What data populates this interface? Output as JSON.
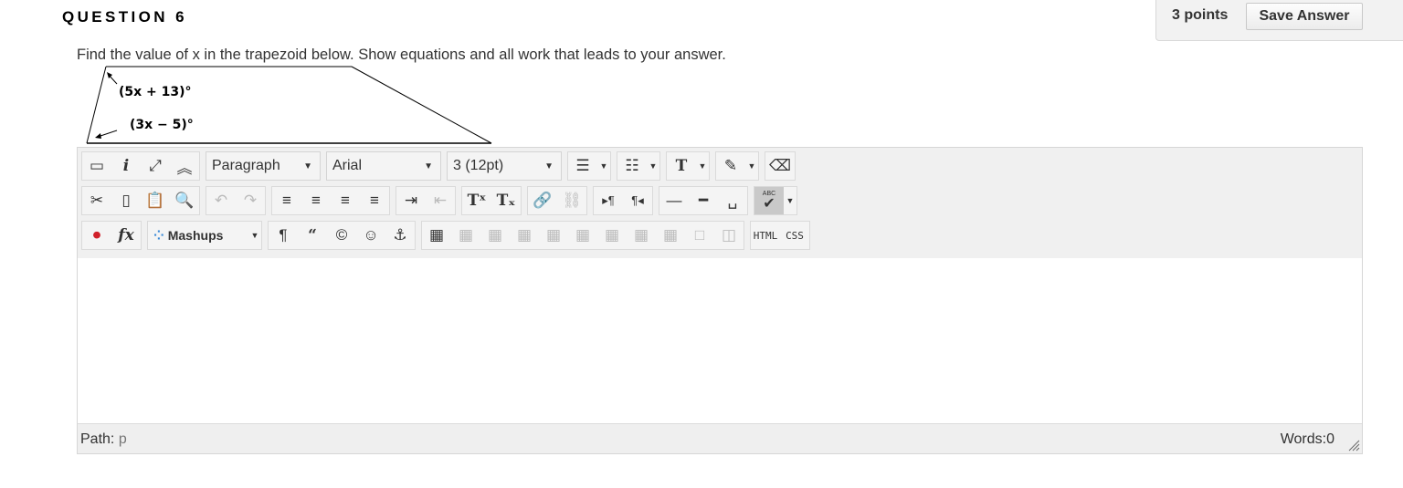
{
  "question": {
    "title": "QUESTION 6",
    "points": "3 points",
    "save_label": "Save Answer",
    "prompt": "Find the value of x in the trapezoid below. Show equations and all work that leads to your answer."
  },
  "figure": {
    "angle_top": "(5x + 13)°",
    "angle_bottom": "(3x − 5)°"
  },
  "toolbar": {
    "format_select": "Paragraph",
    "font_select": "Arial",
    "size_select": "3 (12pt)",
    "mashups_label": "Mashups",
    "html_label": "HTML",
    "css_label": "CSS",
    "abc_label": "ABC"
  },
  "statusbar": {
    "path_label": "Path:",
    "path_value": "p",
    "words": "Words:0"
  }
}
